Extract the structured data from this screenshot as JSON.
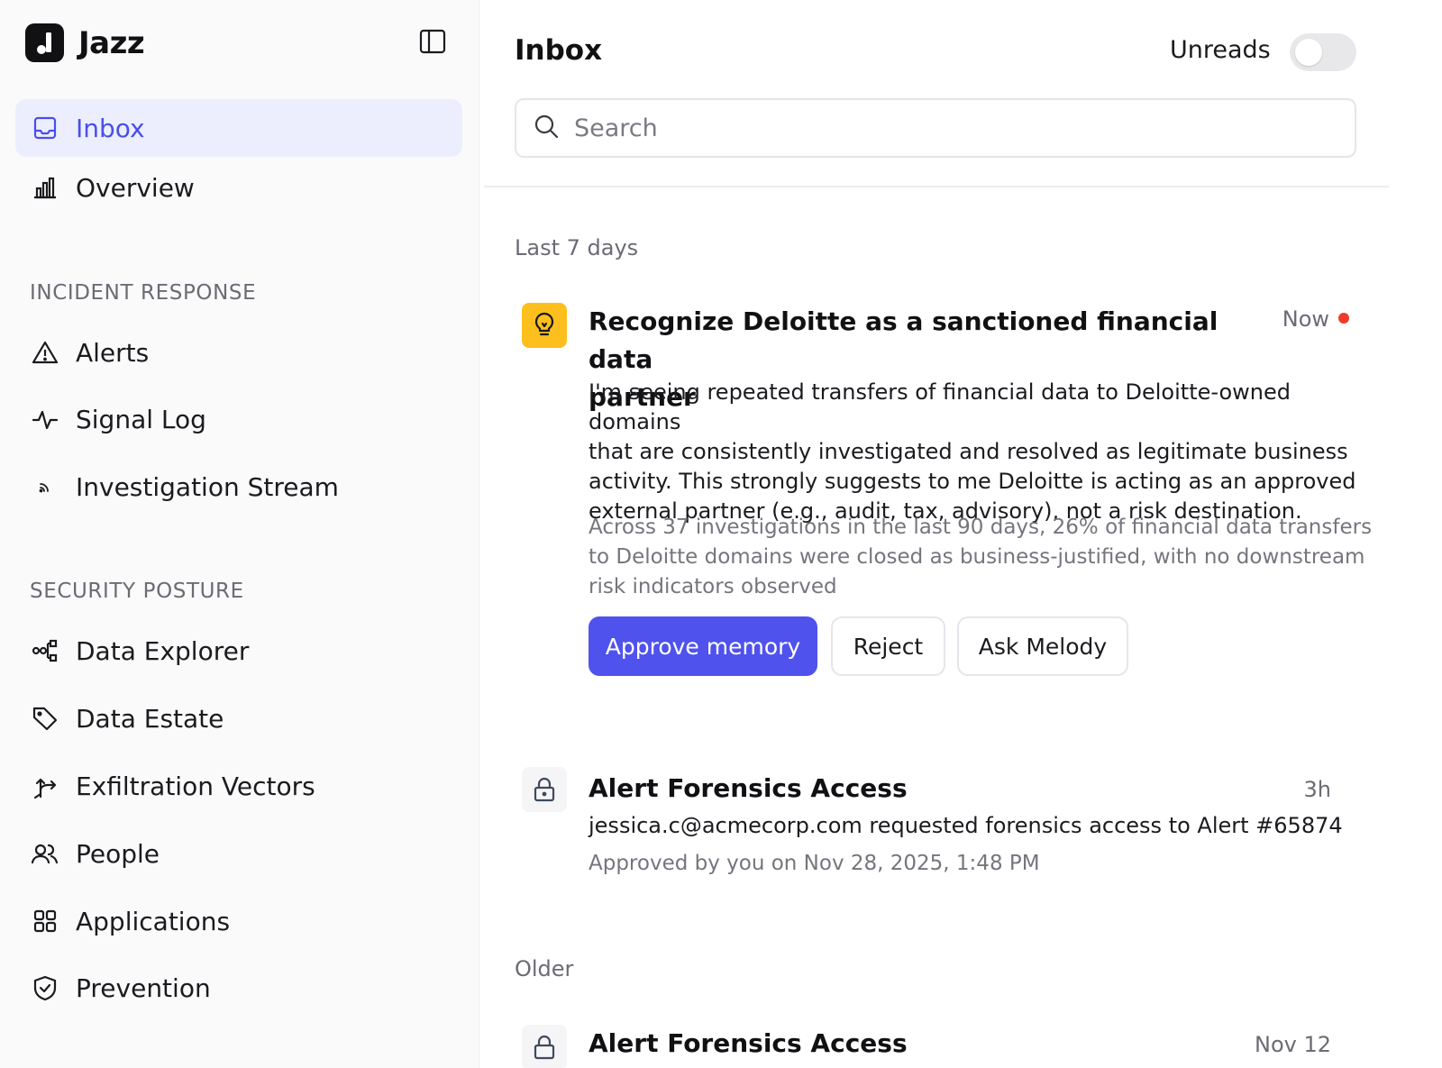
{
  "app": {
    "name": "Jazz",
    "accent": "#4f52ec"
  },
  "sidebar": {
    "collapse_icon": "sidebar-panel-icon",
    "top_items": [
      {
        "label": "Inbox",
        "icon": "inbox-icon",
        "active": true
      },
      {
        "label": "Overview",
        "icon": "bar-chart-icon",
        "active": false
      }
    ],
    "sections": [
      {
        "title": "INCIDENT RESPONSE",
        "items": [
          {
            "label": "Alerts",
            "icon": "warning-triangle-icon"
          },
          {
            "label": "Signal Log",
            "icon": "activity-icon"
          },
          {
            "label": "Investigation Stream",
            "icon": "rss-icon"
          }
        ]
      },
      {
        "title": "SECURITY POSTURE",
        "items": [
          {
            "label": "Data Explorer",
            "icon": "network-icon"
          },
          {
            "label": "Data Estate",
            "icon": "tag-icon"
          },
          {
            "label": "Exfiltration Vectors",
            "icon": "split-arrow-icon"
          },
          {
            "label": "People",
            "icon": "users-icon"
          },
          {
            "label": "Applications",
            "icon": "grid-icon"
          },
          {
            "label": "Prevention",
            "icon": "shield-check-icon"
          }
        ]
      }
    ]
  },
  "header": {
    "title": "Inbox",
    "unreads_label": "Unreads",
    "unreads_enabled": false
  },
  "search": {
    "placeholder": "Search",
    "value": ""
  },
  "groups": [
    {
      "label": "Last 7 days",
      "items": [
        {
          "icon": "lightbulb-icon",
          "title_line1": "Recognize Deloitte as a sanctioned financial data",
          "title_line2": "partner",
          "time": "Now",
          "unread": true,
          "body": [
            "I'm seeing repeated transfers of financial data to Deloitte-owned domains",
            "that are consistently investigated and resolved as legitimate business",
            "activity. This strongly suggests to me Deloitte is acting as an approved",
            "external partner (e.g., audit, tax, advisory), not a risk destination."
          ],
          "evidence": [
            "Across 37 investigations in the last 90 days, 26% of financial data transfers",
            "to Deloitte domains were closed as business-justified, with no downstream",
            "risk indicators observed"
          ],
          "actions": {
            "approve": "Approve memory",
            "reject": "Reject",
            "ask": "Ask Melody"
          }
        },
        {
          "icon": "lock-icon",
          "title": "Alert Forensics Access",
          "time": "3h",
          "body": "jessica.c@acmecorp.com requested forensics access to Alert #65874",
          "sub": "Approved by you on Nov 28, 2025, 1:48 PM"
        }
      ]
    },
    {
      "label": "Older",
      "items": [
        {
          "icon": "lock-icon",
          "title": "Alert Forensics Access",
          "time": "Nov 12"
        }
      ]
    }
  ]
}
